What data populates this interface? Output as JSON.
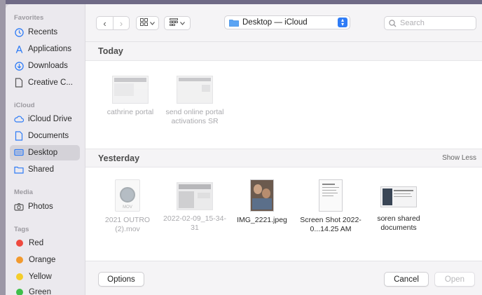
{
  "sidebar": {
    "sections": {
      "favorites": "Favorites",
      "icloud": "iCloud",
      "media": "Media",
      "tags": "Tags"
    },
    "favorites": [
      {
        "label": "Recents",
        "icon": "clock-icon"
      },
      {
        "label": "Applications",
        "icon": "applications-icon"
      },
      {
        "label": "Downloads",
        "icon": "download-icon"
      },
      {
        "label": "Creative C...",
        "icon": "document-icon"
      }
    ],
    "icloud": [
      {
        "label": "iCloud Drive",
        "icon": "cloud-icon"
      },
      {
        "label": "Documents",
        "icon": "folder-icon"
      },
      {
        "label": "Desktop",
        "icon": "desktop-icon",
        "selected": true
      },
      {
        "label": "Shared",
        "icon": "shared-folder-icon"
      }
    ],
    "media": [
      {
        "label": "Photos",
        "icon": "camera-icon"
      }
    ],
    "tags": [
      {
        "label": "Red",
        "color": "#ef4a3f"
      },
      {
        "label": "Orange",
        "color": "#f29a2e"
      },
      {
        "label": "Yellow",
        "color": "#f4cd2a"
      },
      {
        "label": "Green",
        "color": "#3fbf4a"
      }
    ]
  },
  "toolbar": {
    "back_glyph": "‹",
    "forward_glyph": "›",
    "location": "Desktop — iCloud",
    "search_placeholder": "Search",
    "accent": "#2f7cf6"
  },
  "content": {
    "today": {
      "header": "Today",
      "files": [
        "cathrine portal",
        "send online portal activations SR"
      ]
    },
    "yesterday": {
      "header": "Yesterday",
      "toggle": "Show Less",
      "files": [
        "2021 OUTRO (2).mov",
        "2022-02-09_15-34-31",
        "IMG_2221.jpeg",
        "Screen Shot 2022-0...14.25 AM",
        "soren shared documents"
      ],
      "mov_badge": "MOV"
    }
  },
  "footer": {
    "options_label": "Options",
    "cancel_label": "Cancel",
    "open_label": "Open"
  }
}
